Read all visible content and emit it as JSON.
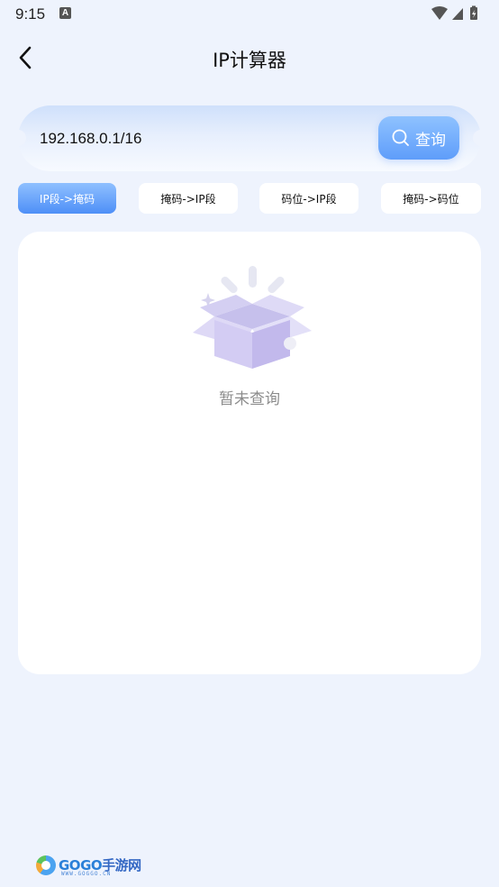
{
  "status_bar": {
    "time": "9:15",
    "notification_icon": "A"
  },
  "header": {
    "title": "IP计算器",
    "back_icon": "chevron-left-icon"
  },
  "search": {
    "value": "192.168.0.1/16",
    "button_label": "查询",
    "button_icon": "search-icon"
  },
  "tabs": [
    {
      "label": "IP段->掩码",
      "active": true
    },
    {
      "label": "掩码->IP段",
      "active": false
    },
    {
      "label": "码位->IP段",
      "active": false
    },
    {
      "label": "掩码->码位",
      "active": false
    }
  ],
  "result": {
    "empty_text": "暂未查询",
    "empty_icon": "open-box-icon"
  },
  "watermark": {
    "brand": "GOGO",
    "brand_cn": "手游网",
    "url": "WWW.GOGGO.CN"
  },
  "colors": {
    "background": "#eef3fd",
    "accent": "#5f9dfa",
    "muted_text": "#8c8c8c"
  }
}
